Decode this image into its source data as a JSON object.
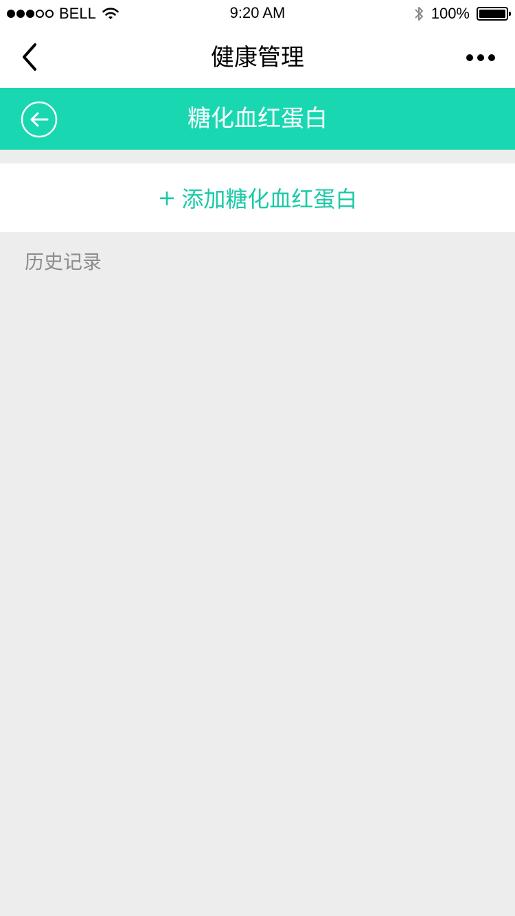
{
  "status_bar": {
    "carrier": "BELL",
    "time": "9:20 AM",
    "battery_text": "100%",
    "signal_filled": 3,
    "signal_total": 5,
    "icons": [
      "wifi-icon",
      "bluetooth-icon",
      "battery-icon"
    ]
  },
  "nav": {
    "title": "健康管理",
    "back_icon": "chevron-left-icon",
    "more_icon": "more-dots-icon"
  },
  "header": {
    "title": "糖化血红蛋白",
    "back_icon": "circle-arrow-left-icon",
    "background_color": "#19d8b1"
  },
  "add": {
    "plus": "+",
    "label": "添加糖化血红蛋白",
    "color": "#19c9a6"
  },
  "history": {
    "label": "历史记录"
  }
}
